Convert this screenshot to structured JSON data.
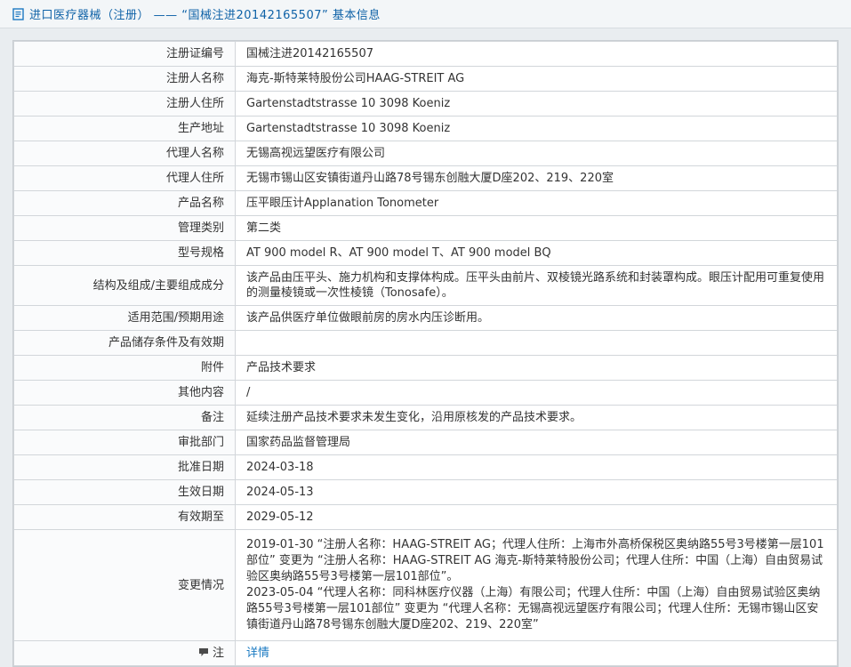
{
  "header": {
    "title": "进口医疗器械（注册） —— “国械注进20142165507” 基本信息"
  },
  "colors": {
    "title_blue": "#0f62a7",
    "link_blue": "#1a7ac2",
    "page_bg": "#e9edf0",
    "table_border": "#d2d6da",
    "label_bg": "#fafbfc"
  },
  "icons": {
    "header": "document-icon",
    "note_row": "comment-icon"
  },
  "table": {
    "rows": [
      {
        "label": "注册证编号",
        "value": "国械注进20142165507"
      },
      {
        "label": "注册人名称",
        "value": "海克-斯特莱特股份公司HAAG-STREIT AG"
      },
      {
        "label": "注册人住所",
        "value": "Gartenstadtstrasse 10 3098 Koeniz"
      },
      {
        "label": "生产地址",
        "value": "Gartenstadtstrasse 10 3098 Koeniz"
      },
      {
        "label": "代理人名称",
        "value": "无锡高视远望医疗有限公司"
      },
      {
        "label": "代理人住所",
        "value": "无锡市锡山区安镇街道丹山路78号锡东创融大厦D座202、219、220室"
      },
      {
        "label": "产品名称",
        "value": "压平眼压计Applanation Tonometer"
      },
      {
        "label": "管理类别",
        "value": "第二类"
      },
      {
        "label": "型号规格",
        "value": "AT 900 model R、AT 900 model T、AT 900 model BQ"
      },
      {
        "label": "结构及组成/主要组成成分",
        "value": "该产品由压平头、施力机构和支撑体构成。压平头由前片、双棱镜光路系统和封装罩构成。眼压计配用可重复使用的测量棱镜或一次性棱镜（Tonosafe）。"
      },
      {
        "label": "适用范围/预期用途",
        "value": "该产品供医疗单位做眼前房的房水内压诊断用。"
      },
      {
        "label": "产品储存条件及有效期",
        "value": ""
      },
      {
        "label": "附件",
        "value": "产品技术要求"
      },
      {
        "label": "其他内容",
        "value": "/"
      },
      {
        "label": "备注",
        "value": "延续注册产品技术要求未发生变化，沿用原核发的产品技术要求。"
      },
      {
        "label": "审批部门",
        "value": "国家药品监督管理局"
      },
      {
        "label": "批准日期",
        "value": "2024-03-18"
      },
      {
        "label": "生效日期",
        "value": "2024-05-13"
      },
      {
        "label": "有效期至",
        "value": "2029-05-12"
      },
      {
        "label": "变更情况",
        "multiline": true,
        "value": "2019-01-30 “注册人名称：HAAG-STREIT AG；代理人住所：上海市外高桥保税区奥纳路55号3号楼第一层101部位” 变更为 “注册人名称：HAAG-STREIT AG 海克-斯特莱特股份公司；代理人住所：中国（上海）自由贸易试验区奥纳路55号3号楼第一层101部位”。\n2023-05-04 “代理人名称：同科林医疗仪器（上海）有限公司；代理人住所：中国（上海）自由贸易试验区奥纳路55号3号楼第一层101部位” 变更为 “代理人名称：无锡高视远望医疗有限公司；代理人住所：无锡市锡山区安镇街道丹山路78号锡东创融大厦D座202、219、220室”"
      },
      {
        "label": "注",
        "label_icon": "comment-icon",
        "value": "详情",
        "link": true
      }
    ]
  }
}
